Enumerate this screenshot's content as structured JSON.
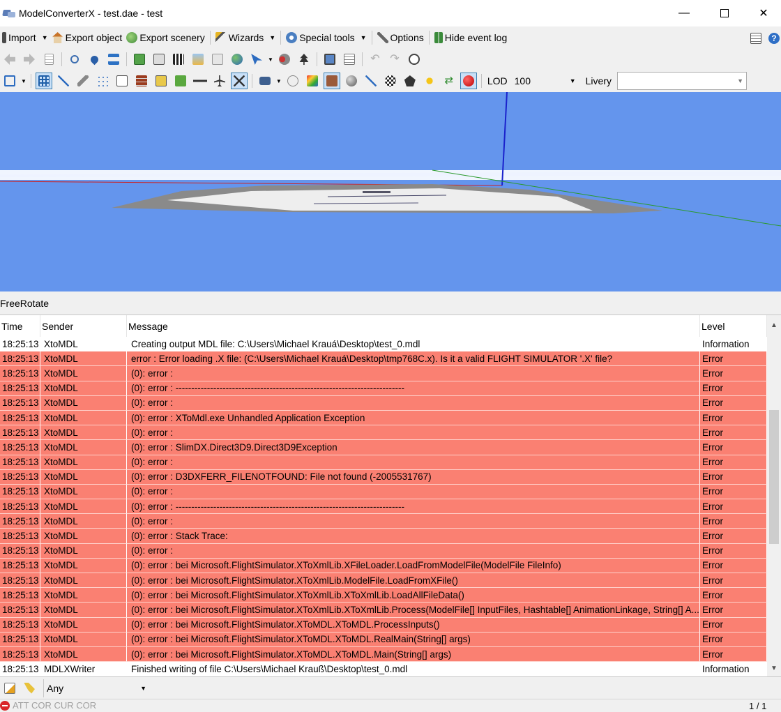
{
  "window": {
    "title": "ModelConverterX - test.dae - test"
  },
  "toolbar1": {
    "import": "Import",
    "export_object": "Export object",
    "export_scenery": "Export scenery",
    "wizards": "Wizards",
    "special_tools": "Special tools",
    "options": "Options",
    "hide_event_log": "Hide event log"
  },
  "toolbar3": {
    "lod_label": "LOD",
    "lod_value": "100",
    "livery_label": "Livery",
    "livery_value": ""
  },
  "status": {
    "mode": "FreeRotate"
  },
  "log": {
    "headers": {
      "time": "Time",
      "sender": "Sender",
      "message": "Message",
      "level": "Level"
    },
    "rows": [
      {
        "time": "18:25:13",
        "sender": "XtoMDL",
        "message": "Creating output MDL file: C:\\Users\\Michael Krauá\\Desktop\\test_0.mdl",
        "level": "Information"
      },
      {
        "time": "18:25:13",
        "sender": "XtoMDL",
        "message": "error : Error loading .X file: (C:\\Users\\Michael Krauá\\Desktop\\tmp768C.x).  Is it a valid FLIGHT SIMULATOR '.X' file?",
        "level": "Error"
      },
      {
        "time": "18:25:13",
        "sender": "XtoMDL",
        "message": "(0): error :",
        "level": "Error"
      },
      {
        "time": "18:25:13",
        "sender": "XtoMDL",
        "message": "(0): error : -------------------------------------------------------------------------",
        "level": "Error"
      },
      {
        "time": "18:25:13",
        "sender": "XtoMDL",
        "message": "(0): error :",
        "level": "Error"
      },
      {
        "time": "18:25:13",
        "sender": "XtoMDL",
        "message": "(0): error : XToMdl.exe Unhandled Application Exception",
        "level": "Error"
      },
      {
        "time": "18:25:13",
        "sender": "XtoMDL",
        "message": "(0): error :",
        "level": "Error"
      },
      {
        "time": "18:25:13",
        "sender": "XtoMDL",
        "message": "(0): error : SlimDX.Direct3D9.Direct3D9Exception",
        "level": "Error"
      },
      {
        "time": "18:25:13",
        "sender": "XtoMDL",
        "message": "(0): error :",
        "level": "Error"
      },
      {
        "time": "18:25:13",
        "sender": "XtoMDL",
        "message": "(0): error : D3DXFERR_FILENOTFOUND: File not found (-2005531767)",
        "level": "Error"
      },
      {
        "time": "18:25:13",
        "sender": "XtoMDL",
        "message": "(0): error :",
        "level": "Error"
      },
      {
        "time": "18:25:13",
        "sender": "XtoMDL",
        "message": "(0): error : -------------------------------------------------------------------------",
        "level": "Error"
      },
      {
        "time": "18:25:13",
        "sender": "XtoMDL",
        "message": "(0): error :",
        "level": "Error"
      },
      {
        "time": "18:25:13",
        "sender": "XtoMDL",
        "message": "(0): error : Stack Trace:",
        "level": "Error"
      },
      {
        "time": "18:25:13",
        "sender": "XtoMDL",
        "message": "(0): error :",
        "level": "Error"
      },
      {
        "time": "18:25:13",
        "sender": "XtoMDL",
        "message": "(0): error :    bei Microsoft.FlightSimulator.XToXmlLib.XFileLoader.LoadFromModelFile(ModelFile FileInfo)",
        "level": "Error"
      },
      {
        "time": "18:25:13",
        "sender": "XtoMDL",
        "message": "(0): error :    bei Microsoft.FlightSimulator.XToXmlLib.ModelFile.LoadFromXFile()",
        "level": "Error"
      },
      {
        "time": "18:25:13",
        "sender": "XtoMDL",
        "message": "(0): error :    bei Microsoft.FlightSimulator.XToXmlLib.XToXmlLib.LoadAllFileData()",
        "level": "Error"
      },
      {
        "time": "18:25:13",
        "sender": "XtoMDL",
        "message": "(0): error :    bei Microsoft.FlightSimulator.XToXmlLib.XToXmlLib.Process(ModelFile[] InputFiles, Hashtable[] AnimationLinkage, String[] A...",
        "level": "Error"
      },
      {
        "time": "18:25:13",
        "sender": "XtoMDL",
        "message": "(0): error :    bei Microsoft.FlightSimulator.XToMDL.XToMDL.ProcessInputs()",
        "level": "Error"
      },
      {
        "time": "18:25:13",
        "sender": "XtoMDL",
        "message": "(0): error :    bei Microsoft.FlightSimulator.XToMDL.XToMDL.RealMain(String[] args)",
        "level": "Error"
      },
      {
        "time": "18:25:13",
        "sender": "XtoMDL",
        "message": "(0): error :    bei Microsoft.FlightSimulator.XToMDL.XToMDL.Main(String[] args)",
        "level": "Error"
      },
      {
        "time": "18:25:13",
        "sender": "MDLXWriter",
        "message": "Finished writing of file C:\\Users\\Michael Krauß\\Desktop\\test_0.mdl",
        "level": "Information"
      }
    ]
  },
  "filter": {
    "value": "Any"
  },
  "bottom": {
    "text": "ATT COR  CUR COR",
    "pager": "1 / 1"
  },
  "colors": {
    "error_row": "#fa8072",
    "viewport_bg": "#6495ed",
    "accent": "#3c7fb1"
  }
}
